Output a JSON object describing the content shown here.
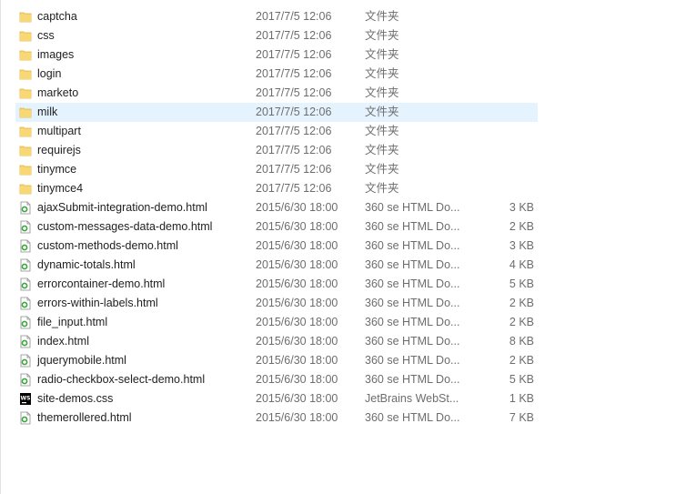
{
  "files": [
    {
      "name": "captcha",
      "date": "2017/7/5 12:06",
      "type": "文件夹",
      "size": "",
      "kind": "folder",
      "icon": "folder-icon"
    },
    {
      "name": "css",
      "date": "2017/7/5 12:06",
      "type": "文件夹",
      "size": "",
      "kind": "folder",
      "icon": "folder-icon"
    },
    {
      "name": "images",
      "date": "2017/7/5 12:06",
      "type": "文件夹",
      "size": "",
      "kind": "folder",
      "icon": "folder-icon"
    },
    {
      "name": "login",
      "date": "2017/7/5 12:06",
      "type": "文件夹",
      "size": "",
      "kind": "folder",
      "icon": "folder-icon"
    },
    {
      "name": "marketo",
      "date": "2017/7/5 12:06",
      "type": "文件夹",
      "size": "",
      "kind": "folder",
      "icon": "folder-icon"
    },
    {
      "name": "milk",
      "date": "2017/7/5 12:06",
      "type": "文件夹",
      "size": "",
      "kind": "folder",
      "icon": "folder-icon",
      "selected": true
    },
    {
      "name": "multipart",
      "date": "2017/7/5 12:06",
      "type": "文件夹",
      "size": "",
      "kind": "folder",
      "icon": "folder-icon"
    },
    {
      "name": "requirejs",
      "date": "2017/7/5 12:06",
      "type": "文件夹",
      "size": "",
      "kind": "folder",
      "icon": "folder-icon"
    },
    {
      "name": "tinymce",
      "date": "2017/7/5 12:06",
      "type": "文件夹",
      "size": "",
      "kind": "folder",
      "icon": "folder-icon"
    },
    {
      "name": "tinymce4",
      "date": "2017/7/5 12:06",
      "type": "文件夹",
      "size": "",
      "kind": "folder",
      "icon": "folder-icon"
    },
    {
      "name": "ajaxSubmit-integration-demo.html",
      "date": "2015/6/30 18:00",
      "type": "360 se HTML Do...",
      "size": "3 KB",
      "kind": "html",
      "icon": "html-file-icon"
    },
    {
      "name": "custom-messages-data-demo.html",
      "date": "2015/6/30 18:00",
      "type": "360 se HTML Do...",
      "size": "2 KB",
      "kind": "html",
      "icon": "html-file-icon"
    },
    {
      "name": "custom-methods-demo.html",
      "date": "2015/6/30 18:00",
      "type": "360 se HTML Do...",
      "size": "3 KB",
      "kind": "html",
      "icon": "html-file-icon"
    },
    {
      "name": "dynamic-totals.html",
      "date": "2015/6/30 18:00",
      "type": "360 se HTML Do...",
      "size": "4 KB",
      "kind": "html",
      "icon": "html-file-icon"
    },
    {
      "name": "errorcontainer-demo.html",
      "date": "2015/6/30 18:00",
      "type": "360 se HTML Do...",
      "size": "5 KB",
      "kind": "html",
      "icon": "html-file-icon"
    },
    {
      "name": "errors-within-labels.html",
      "date": "2015/6/30 18:00",
      "type": "360 se HTML Do...",
      "size": "2 KB",
      "kind": "html",
      "icon": "html-file-icon"
    },
    {
      "name": "file_input.html",
      "date": "2015/6/30 18:00",
      "type": "360 se HTML Do...",
      "size": "2 KB",
      "kind": "html",
      "icon": "html-file-icon"
    },
    {
      "name": "index.html",
      "date": "2015/6/30 18:00",
      "type": "360 se HTML Do...",
      "size": "8 KB",
      "kind": "html",
      "icon": "html-file-icon"
    },
    {
      "name": "jquerymobile.html",
      "date": "2015/6/30 18:00",
      "type": "360 se HTML Do...",
      "size": "2 KB",
      "kind": "html",
      "icon": "html-file-icon"
    },
    {
      "name": "radio-checkbox-select-demo.html",
      "date": "2015/6/30 18:00",
      "type": "360 se HTML Do...",
      "size": "5 KB",
      "kind": "html",
      "icon": "html-file-icon"
    },
    {
      "name": "site-demos.css",
      "date": "2015/6/30 18:00",
      "type": "JetBrains WebSt...",
      "size": "1 KB",
      "kind": "ws",
      "icon": "webstorm-file-icon"
    },
    {
      "name": "themerollered.html",
      "date": "2015/6/30 18:00",
      "type": "360 se HTML Do...",
      "size": "7 KB",
      "kind": "html",
      "icon": "html-file-icon"
    }
  ],
  "colors": {
    "folder": "#f8d775",
    "folder_dark": "#e0b040",
    "selected_bg": "#e5f3ff",
    "html_icon_green": "#3aa53a",
    "ws_icon": "#000000"
  }
}
